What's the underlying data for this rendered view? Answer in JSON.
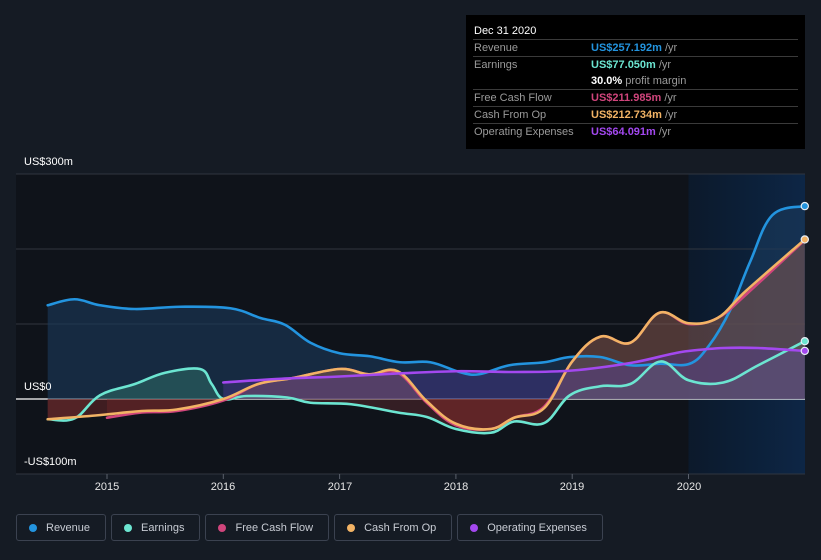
{
  "tooltip": {
    "date": "Dec 31 2020",
    "rows": [
      {
        "label": "Revenue",
        "value": "US$257.192m",
        "unit": "/yr",
        "color": "#2394df"
      },
      {
        "label": "Earnings",
        "value": "US$77.050m",
        "unit": "/yr",
        "color": "#6ce5d1"
      },
      {
        "label": "",
        "value": "30.0%",
        "unit": "profit margin",
        "color": "#ffffff"
      },
      {
        "label": "Free Cash Flow",
        "value": "US$211.985m",
        "unit": "/yr",
        "color": "#d0457c"
      },
      {
        "label": "Cash From Op",
        "value": "US$212.734m",
        "unit": "/yr",
        "color": "#f2b365"
      },
      {
        "label": "Operating Expenses",
        "value": "US$64.091m",
        "unit": "/yr",
        "color": "#a348ef"
      }
    ]
  },
  "legend": [
    {
      "label": "Revenue",
      "color": "#2394df"
    },
    {
      "label": "Earnings",
      "color": "#6ce5d1"
    },
    {
      "label": "Free Cash Flow",
      "color": "#d0457c"
    },
    {
      "label": "Cash From Op",
      "color": "#f2b365"
    },
    {
      "label": "Operating Expenses",
      "color": "#a348ef"
    }
  ],
  "chart_data": {
    "type": "area",
    "title": "",
    "xlabel": "",
    "ylabel": "",
    "y_unit": "US$ millions",
    "ylim": [
      -100,
      300
    ],
    "yticks": [
      {
        "value": 300,
        "label": "US$300m"
      },
      {
        "value": 0,
        "label": "US$0"
      },
      {
        "value": -100,
        "label": "-US$100m"
      }
    ],
    "gridlines": [
      300,
      200,
      100,
      0,
      -100
    ],
    "xlim": [
      2014.49,
      2021.0
    ],
    "xticks": [
      {
        "value": 2015,
        "label": "2015"
      },
      {
        "value": 2016,
        "label": "2016"
      },
      {
        "value": 2017,
        "label": "2017"
      },
      {
        "value": 2018,
        "label": "2018"
      },
      {
        "value": 2019,
        "label": "2019"
      },
      {
        "value": 2020,
        "label": "2020"
      }
    ],
    "highlight_start": 2020.0,
    "legend_position": "bottom",
    "series": [
      {
        "name": "Revenue",
        "color": "#2394df",
        "x": [
          2014.49,
          2014.72,
          2014.94,
          2015.24,
          2015.63,
          2016.06,
          2016.32,
          2016.53,
          2016.75,
          2017.0,
          2017.26,
          2017.52,
          2017.78,
          2018.03,
          2018.2,
          2018.46,
          2018.76,
          2018.98,
          2019.24,
          2019.5,
          2019.76,
          2020.01,
          2020.18,
          2020.36,
          2020.53,
          2020.72,
          2021.0
        ],
        "y": [
          125,
          133,
          125,
          120,
          123,
          121,
          108,
          99,
          75,
          61,
          57,
          49,
          49,
          36,
          33,
          45,
          49,
          56,
          56,
          45,
          47,
          47,
          72,
          119,
          183,
          245,
          257.2
        ]
      },
      {
        "name": "Earnings",
        "color": "#6ce5d1",
        "x": [
          2014.49,
          2014.72,
          2014.94,
          2015.24,
          2015.5,
          2015.8,
          2015.9,
          2016.0,
          2016.2,
          2016.55,
          2016.75,
          2017.1,
          2017.5,
          2017.75,
          2018.0,
          2018.3,
          2018.5,
          2018.76,
          2018.98,
          2019.24,
          2019.5,
          2019.76,
          2020.0,
          2020.3,
          2020.6,
          2021.0
        ],
        "y": [
          -27,
          -26,
          5,
          20,
          35,
          40,
          20,
          0,
          4,
          2,
          -5,
          -7,
          -18,
          -24,
          -40,
          -45,
          -30,
          -32,
          5,
          17,
          20,
          50,
          25,
          22,
          45,
          77.05
        ]
      },
      {
        "name": "Free Cash Flow",
        "color": "#d0457c",
        "x": [
          2015.0,
          2015.3,
          2015.6,
          2016.0,
          2016.3,
          2016.6,
          2017.0,
          2017.25,
          2017.5,
          2017.75,
          2018.0,
          2018.3,
          2018.5,
          2018.76,
          2019.0,
          2019.24,
          2019.5,
          2019.75,
          2020.0,
          2020.25,
          2020.5,
          2021.0
        ],
        "y": [
          -25,
          -18,
          -16,
          -2,
          20,
          28,
          40,
          33,
          35,
          -5,
          -35,
          -40,
          -25,
          -10,
          50,
          83,
          75,
          115,
          100,
          108,
          140,
          211.985
        ]
      },
      {
        "name": "Cash From Op",
        "color": "#f2b365",
        "x": [
          2014.49,
          2014.9,
          2015.3,
          2015.6,
          2016.0,
          2016.3,
          2016.6,
          2017.0,
          2017.25,
          2017.5,
          2017.75,
          2018.0,
          2018.3,
          2018.5,
          2018.76,
          2019.0,
          2019.24,
          2019.5,
          2019.75,
          2020.0,
          2020.25,
          2020.5,
          2021.0
        ],
        "y": [
          -27,
          -22,
          -16,
          -14,
          0,
          20,
          28,
          40,
          33,
          37,
          -3,
          -33,
          -40,
          -25,
          -12,
          50,
          83,
          75,
          115,
          101,
          108,
          145,
          212.734
        ]
      },
      {
        "name": "Operating Expenses",
        "color": "#a348ef",
        "x": [
          2016.0,
          2016.5,
          2017.0,
          2017.5,
          2018.0,
          2018.5,
          2019.0,
          2019.5,
          2019.85,
          2020.0,
          2020.3,
          2020.6,
          2021.0
        ],
        "y": [
          22,
          27,
          30,
          34,
          37,
          36,
          38,
          48,
          60,
          64,
          68,
          68,
          64.091
        ]
      }
    ]
  }
}
